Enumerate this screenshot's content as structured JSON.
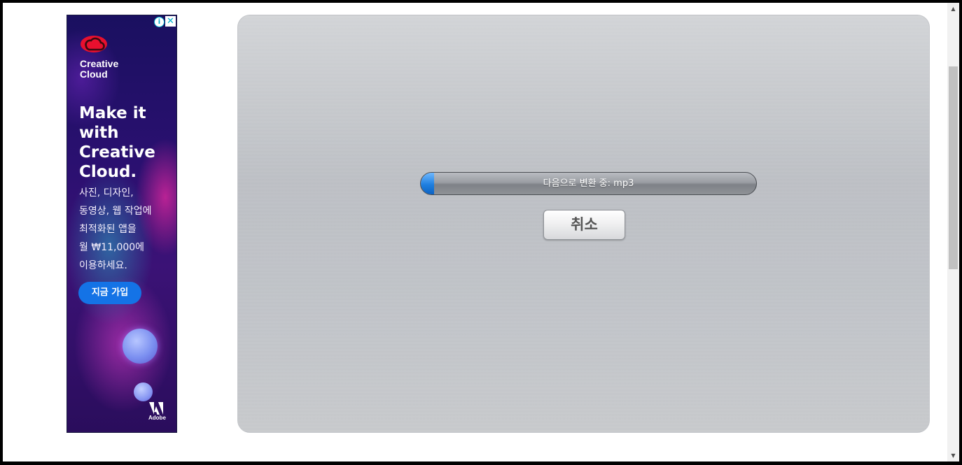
{
  "ad": {
    "info_icon": "info-icon",
    "close_icon": "close-icon",
    "brand_name": "Creative\nCloud",
    "headline": "Make it\nwith\nCreative\nCloud.",
    "body": "사진, 디자인,\n동영상, 웹 작업에\n최적화된 앱을\n월 ₩11,000에\n이용하세요.",
    "cta_label": "지금 가입",
    "footer_logo_text": "Adobe",
    "colors": {
      "cta": "#1473e6",
      "background": "#2a1070",
      "logo": "#e8102e"
    }
  },
  "converter": {
    "progress_label": "다음으로 변환 중: mp3",
    "progress_fraction": 0.04,
    "cancel_label": "취소",
    "colors": {
      "progress_fill": "#1f7fe0",
      "panel": "#c1c4c9"
    }
  },
  "scrollbar": {
    "up_icon": "▲",
    "down_icon": "▼"
  }
}
